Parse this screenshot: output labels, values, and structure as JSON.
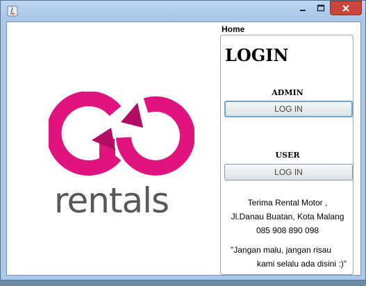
{
  "window": {
    "title": "",
    "titlebar_color": "#a9c9ec",
    "close_color": "#c9463d"
  },
  "logo": {
    "brand_text": "rentals",
    "brand_logo": "GO",
    "pink": "#e0137f",
    "gray": "#58585a"
  },
  "panel": {
    "home_label": "Home",
    "login_title": "LOGIN",
    "admin_label": "ADMIN",
    "admin_button": "LOG IN",
    "user_label": "USER",
    "user_button": "LOG IN",
    "info_lines": [
      "Terima Rental Motor ,",
      "Jl.Danau Buatan, Kota Malang",
      "085 908 890 098"
    ],
    "quote_line1": "\"Jangan malu, jangan risau",
    "quote_line2": "kami selalu ada disini :)\""
  }
}
